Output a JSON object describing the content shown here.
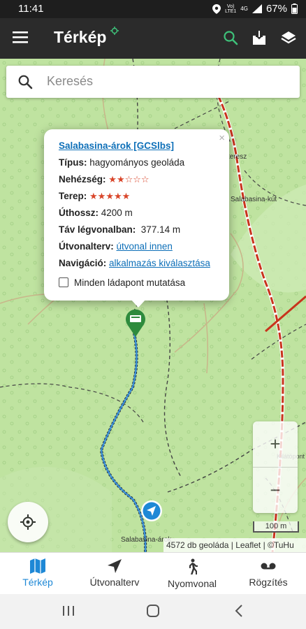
{
  "status": {
    "time": "11:41",
    "network_line1": "Vo)",
    "network_line2": "LTE1",
    "network_type": "4G",
    "battery": "67%"
  },
  "appbar": {
    "title": "Térkép"
  },
  "search": {
    "placeholder": "Keresés"
  },
  "map_labels": {
    "label1": "teresz",
    "label2": "Salabasina-kút",
    "label3": "Kilátópont",
    "label4": "Salabasina-árok"
  },
  "popup": {
    "title_link": "Salabasina-árok [GCSlbs]",
    "close": "×",
    "type_label": "Típus:",
    "type_value": "hagyományos geoláda",
    "difficulty_label": "Nehézség:",
    "difficulty_rating": 2,
    "difficulty_stars": "★★☆☆☆",
    "terrain_label": "Terep:",
    "terrain_rating": 4.5,
    "terrain_stars": "★★★★★",
    "length_label": "Úthossz:",
    "length_value": "4200 m",
    "distance_label": "Táv légvonalban:",
    "distance_value": "377.14 m",
    "route_label": "Útvonalterv:",
    "route_link": "útvonal innen",
    "nav_label": "Navigáció:",
    "nav_link": "alkalmazás kiválasztása",
    "checkbox_label": "Minden ládapont mutatása"
  },
  "zoom": {
    "plus": "+",
    "minus": "−"
  },
  "scale": "100 m",
  "attribution": "4572 db geoláda | Leaflet | ©TuHu",
  "bottom_nav": [
    {
      "label": "Térkép",
      "icon": "map-icon",
      "active": true
    },
    {
      "label": "Útvonalterv",
      "icon": "navigation-arrow-icon",
      "active": false
    },
    {
      "label": "Nyomvonal",
      "icon": "walking-icon",
      "active": false
    },
    {
      "label": "Rögzítés",
      "icon": "voicemail-icon",
      "active": false
    }
  ],
  "colors": {
    "accent": "#1e88d6",
    "appbar": "#2b2b2b",
    "map_bg": "#bfe3a0",
    "search_icon_active": "#3ec27a",
    "stars": "#d9452a",
    "marker": "#2e8b3d",
    "track": "#3b8fd6"
  }
}
